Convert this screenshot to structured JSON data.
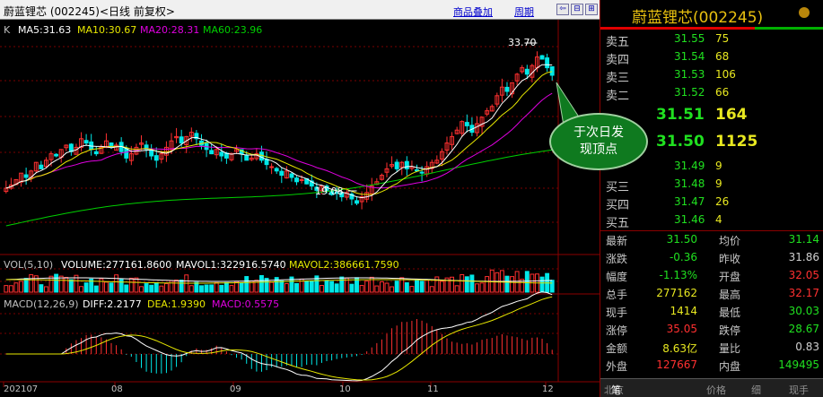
{
  "header": {
    "title": "蔚蓝锂芯 (002245)<日线 前复权>",
    "link_overlay": "商品叠加",
    "link_period": "周期",
    "nav_buttons": [
      "⇦",
      "⊟",
      "⊞"
    ]
  },
  "ma_legend": {
    "k_label": "K",
    "ma5": "MA5:31.63",
    "ma10": "MA10:30.67",
    "ma20": "MA20:28.31",
    "ma60": "MA60:23.96",
    "colors": {
      "ma5": "#ffffff",
      "ma10": "#e8e800",
      "ma20": "#e000e0",
      "ma60": "#00d000"
    }
  },
  "annotations": {
    "high_label": "33.70",
    "low_label": "19.08",
    "callout_line1": "于次日发",
    "callout_line2": "现顶点"
  },
  "vol_legend": {
    "vol": "VOL(5,10)",
    "volume": "VOLUME:277161.8600",
    "mavol1": "MAVOL1:322916.5740",
    "mavol2": "MAVOL2:386661.7590"
  },
  "macd_legend": {
    "macd": "MACD(12,26,9)",
    "diff": "DIFF:2.2177",
    "dea": "DEA:1.9390",
    "macd_val": "MACD:0.5575"
  },
  "x_axis": [
    "202107",
    "08",
    "09",
    "10",
    "11",
    "12"
  ],
  "chart_data": {
    "type": "candlestick",
    "title": "蔚蓝锂芯 (002245)<日线 前复权>",
    "x_ticks": [
      "202107",
      "08",
      "09",
      "10",
      "11",
      "12"
    ],
    "y_range": [
      16,
      35
    ],
    "high": 33.7,
    "low": 19.08,
    "close_series": [
      21.0,
      21.3,
      21.8,
      22.4,
      22.0,
      22.6,
      23.4,
      22.8,
      23.6,
      24.2,
      24.0,
      24.6,
      25.0,
      24.4,
      24.8,
      25.6,
      25.2,
      24.6,
      24.2,
      24.8,
      25.4,
      24.8,
      25.0,
      24.4,
      23.8,
      24.2,
      24.8,
      25.2,
      24.6,
      24.0,
      23.6,
      24.2,
      24.8,
      25.4,
      25.8,
      25.2,
      25.8,
      26.2,
      25.6,
      25.0,
      24.6,
      24.2,
      24.6,
      24.0,
      23.8,
      24.2,
      24.6,
      24.2,
      23.6,
      23.8,
      24.2,
      23.6,
      23.2,
      23.0,
      22.6,
      22.2,
      22.6,
      22.0,
      21.6,
      21.8,
      21.4,
      21.2,
      20.8,
      21.2,
      20.8,
      20.4,
      20.6,
      20.2,
      20.6,
      20.0,
      19.6,
      20.2,
      20.6,
      21.2,
      21.6,
      22.2,
      22.8,
      23.2,
      22.8,
      23.4,
      22.8,
      23.0,
      22.6,
      22.4,
      23.0,
      23.4,
      23.6,
      24.4,
      25.2,
      25.8,
      26.4,
      27.2,
      26.8,
      26.2,
      27.0,
      27.6,
      28.2,
      28.6,
      29.6,
      30.4,
      30.0,
      30.8,
      31.6,
      32.2,
      31.6,
      32.4,
      33.2,
      33.0,
      32.2,
      31.5
    ],
    "ma5": 31.63,
    "ma10": 30.67,
    "ma20": 28.31,
    "ma60": 23.96
  },
  "panel": {
    "title": "蔚蓝锂芯(002245)",
    "sell": [
      {
        "label": "卖五",
        "price": "31.55",
        "vol": "75"
      },
      {
        "label": "卖四",
        "price": "31.54",
        "vol": "68"
      },
      {
        "label": "卖三",
        "price": "31.53",
        "vol": "106"
      },
      {
        "label": "卖二",
        "price": "31.52",
        "vol": "66"
      }
    ],
    "sell1": {
      "price": "31.51",
      "vol": "164"
    },
    "buy1": {
      "price": "31.50",
      "vol": "1125"
    },
    "buy": [
      {
        "label": "",
        "price": "31.49",
        "vol": "9"
      },
      {
        "label": "买三",
        "price": "31.48",
        "vol": "9"
      },
      {
        "label": "买四",
        "price": "31.47",
        "vol": "26"
      },
      {
        "label": "买五",
        "price": "31.46",
        "vol": "4"
      }
    ],
    "stats": [
      {
        "l1": "最新",
        "v1": "31.50",
        "c1": "#20e020",
        "l2": "均价",
        "v2": "31.14",
        "c2": "#20e020"
      },
      {
        "l1": "涨跌",
        "v1": "-0.36",
        "c1": "#20e020",
        "l2": "昨收",
        "v2": "31.86",
        "c2": "#d0d0d0"
      },
      {
        "l1": "幅度",
        "v1": "-1.13%",
        "c1": "#20e020",
        "l2": "开盘",
        "v2": "32.05",
        "c2": "#ff3030"
      },
      {
        "l1": "总手",
        "v1": "277162",
        "c1": "#e8e820",
        "l2": "最高",
        "v2": "32.17",
        "c2": "#ff3030"
      },
      {
        "l1": "现手",
        "v1": "1414",
        "c1": "#e8e820",
        "l2": "最低",
        "v2": "30.03",
        "c2": "#20e020"
      },
      {
        "l1": "涨停",
        "v1": "35.05",
        "c1": "#ff3030",
        "l2": "跌停",
        "v2": "28.67",
        "c2": "#20e020"
      },
      {
        "l1": "金额",
        "v1": "8.63亿",
        "c1": "#e8e820",
        "l2": "量比",
        "v2": "0.83",
        "c2": "#d0d0d0"
      },
      {
        "l1": "外盘",
        "v1": "127667",
        "c1": "#ff3030",
        "l2": "内盘",
        "v2": "149495",
        "c2": "#20e020"
      }
    ],
    "tabs": [
      "北京",
      "笔",
      "价格",
      "细",
      "现手"
    ]
  }
}
